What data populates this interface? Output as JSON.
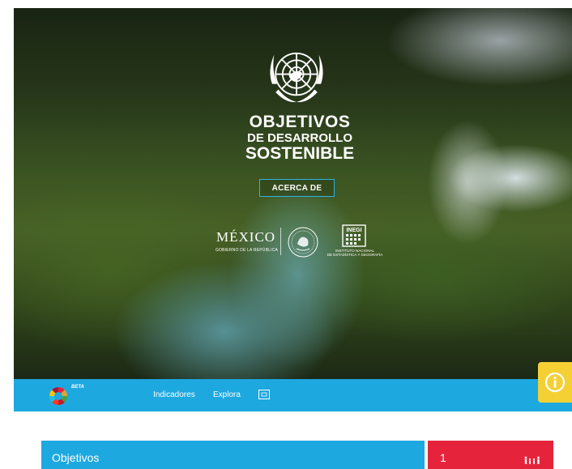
{
  "hero": {
    "title_line1": "OBJETIVOS",
    "title_line2": "DE DESARROLLO",
    "title_line3": "SOSTENIBLE",
    "about_button": "ACERCA DE",
    "partner_mexico": "MÉXICO",
    "partner_gobierno": "GOBIERNO DE LA REPÚBLICA",
    "partner_inegi_line1": "INSTITUTO NACIONAL",
    "partner_inegi_line2": "DE ESTADÍSTICA Y GEOGRAFÍA",
    "inegi_logo_text": "INEGI"
  },
  "nav": {
    "beta_badge": "BETA",
    "items": [
      {
        "label": "Indicadores"
      },
      {
        "label": "Explora"
      }
    ]
  },
  "section": {
    "goals_label": "Objetivos",
    "goal_card_number": "1"
  },
  "colors": {
    "nav_blue": "#1ea8e0",
    "goal1_red": "#e5243b",
    "info_yellow": "#f5d034"
  },
  "icons": [
    "un-emblem-icon",
    "sdg-wheel-icon",
    "info-icon",
    "map-icon",
    "poverty-family-icon",
    "mexico-seal-icon"
  ]
}
